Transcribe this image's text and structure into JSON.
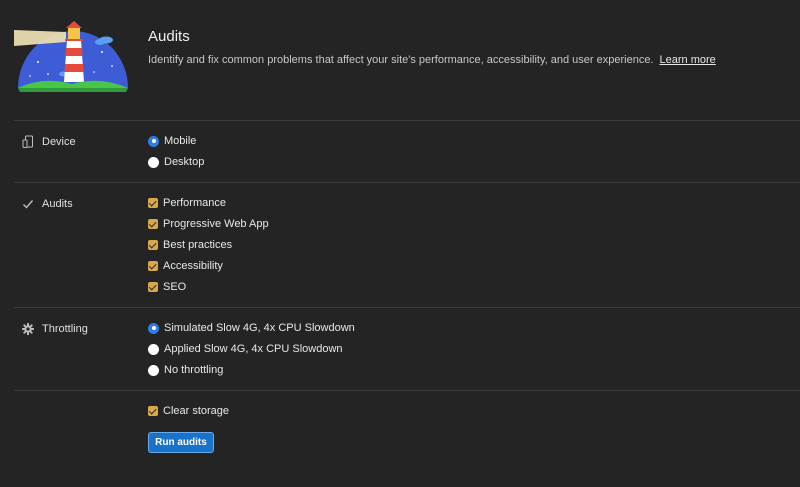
{
  "header": {
    "title": "Audits",
    "description": "Identify and fix common problems that affect your site's performance, accessibility, and user experience.",
    "learn_more": "Learn more"
  },
  "sections": {
    "device": {
      "label": "Device",
      "icon": "device-icon",
      "options": [
        {
          "label": "Mobile",
          "selected": true
        },
        {
          "label": "Desktop",
          "selected": false
        }
      ]
    },
    "audits": {
      "label": "Audits",
      "icon": "checkmark-icon",
      "options": [
        {
          "label": "Performance",
          "checked": true
        },
        {
          "label": "Progressive Web App",
          "checked": true
        },
        {
          "label": "Best practices",
          "checked": true
        },
        {
          "label": "Accessibility",
          "checked": true
        },
        {
          "label": "SEO",
          "checked": true
        }
      ]
    },
    "throttling": {
      "label": "Throttling",
      "icon": "gear-icon",
      "options": [
        {
          "label": "Simulated Slow 4G, 4x CPU Slowdown",
          "selected": true
        },
        {
          "label": "Applied Slow 4G, 4x CPU Slowdown",
          "selected": false
        },
        {
          "label": "No throttling",
          "selected": false
        }
      ]
    }
  },
  "clear_storage": {
    "label": "Clear storage",
    "checked": true
  },
  "run_button": "Run audits",
  "colors": {
    "background": "#242424",
    "accent_blue": "#2f7de1",
    "checkbox": "#d7a84c",
    "button": "#1a73c8"
  }
}
